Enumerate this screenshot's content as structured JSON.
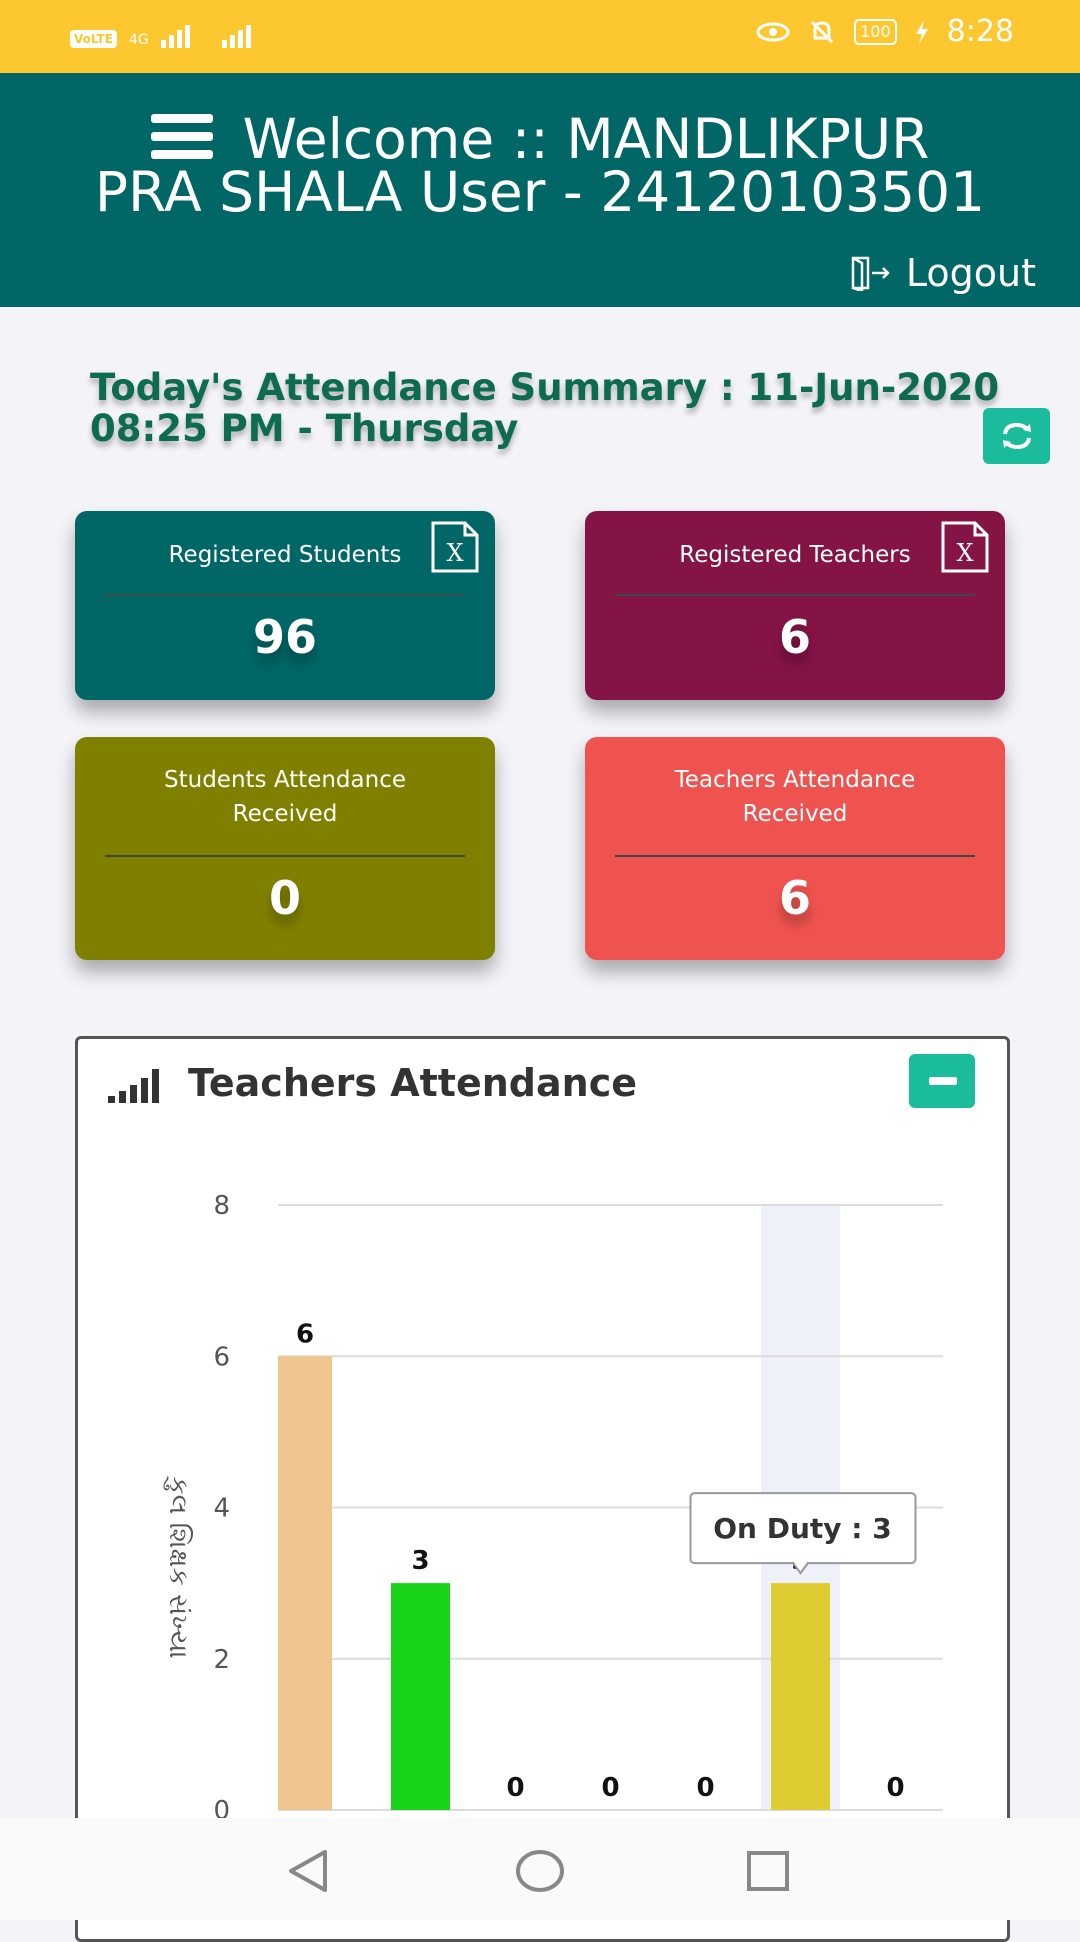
{
  "status_bar": {
    "network_badge": "VoLTE",
    "network_type": "4G",
    "battery": "100",
    "time": "8:28",
    "icons": [
      "eye-icon",
      "bell-off-icon",
      "battery-icon",
      "charging-icon"
    ]
  },
  "header": {
    "welcome_line1": "Welcome :: MANDLIKPUR",
    "welcome_line2": "PRA SHALA User - 24120103501",
    "logout_label": "Logout",
    "background": "#006666"
  },
  "summary": {
    "line1": "Today's Attendance Summary : 11-Jun-2020",
    "line2": "08:25 PM - Thursday"
  },
  "cards": {
    "registered_students": {
      "label": "Registered Students",
      "value": "96",
      "color": "#006666"
    },
    "registered_teachers": {
      "label": "Registered Teachers",
      "value": "6",
      "color": "#841346"
    },
    "students_attendance": {
      "label_line1": "Students Attendance",
      "label_line2": "Received",
      "value": "0",
      "color": "#808000"
    },
    "teachers_attendance": {
      "label_line1": "Teachers Attendance",
      "label_line2": "Received",
      "value": "6",
      "color": "#ef5350"
    }
  },
  "panel": {
    "title": "Teachers Attendance"
  },
  "chart_data": {
    "type": "bar",
    "ylabel": "કુલ શિક્ષક સંખ્યા",
    "ylim": [
      0,
      8
    ],
    "yticks": [
      0,
      2,
      4,
      6,
      8
    ],
    "values": [
      6,
      3,
      0,
      0,
      0,
      3,
      0
    ],
    "colors": [
      "#f1c68e",
      "#19d319",
      "#999999",
      "#999999",
      "#999999",
      "#dfcc33",
      "#999999"
    ],
    "highlight_index": 5,
    "tooltip": "On Duty : 3",
    "grid": true
  }
}
